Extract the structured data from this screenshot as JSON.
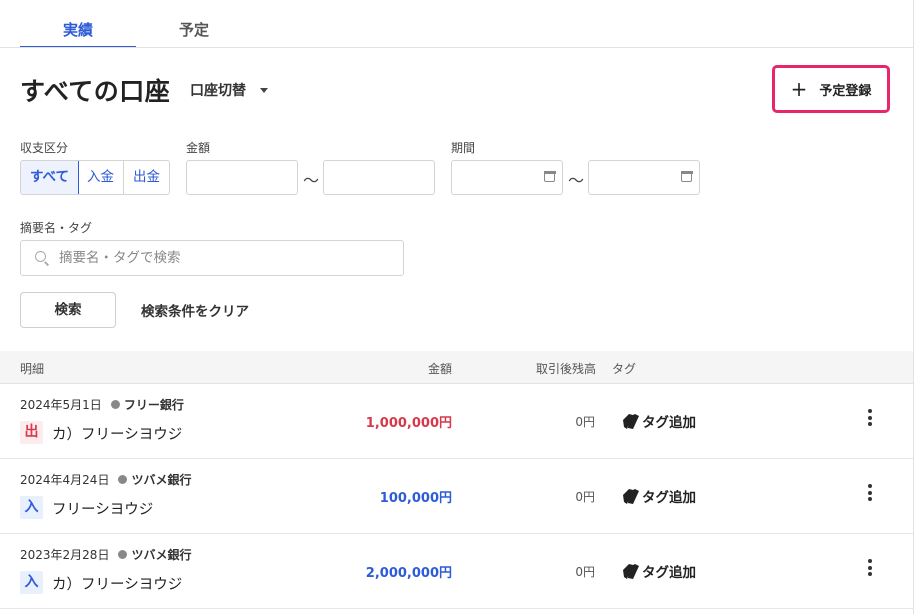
{
  "tabs": [
    {
      "label": "実績",
      "active": true
    },
    {
      "label": "予定",
      "active": false
    }
  ],
  "header": {
    "title": "すべての口座",
    "account_switch_label": "口座切替",
    "plan_button_label": "予定登録",
    "plan_button_icon": "plus-icon",
    "highlight_color": "#e8266b"
  },
  "filters": {
    "type_label": "収支区分",
    "type_options": [
      "すべて",
      "入金",
      "出金"
    ],
    "type_selected": "すべて",
    "amount_label": "金額",
    "amount_from": "",
    "amount_to": "",
    "range_separator": "〜",
    "period_label": "期間",
    "period_from": "",
    "period_to": "",
    "keyword_label": "摘要名・タグ",
    "keyword_placeholder": "摘要名・タグで検索",
    "search_button": "検索",
    "clear_button": "検索条件をクリア"
  },
  "table": {
    "headers": {
      "detail": "明細",
      "amount": "金額",
      "balance": "取引後残高",
      "tag": "タグ"
    },
    "rows": [
      {
        "date": "2024年5月1日",
        "bank": "フリー銀行",
        "kind": "出",
        "desc": "カ）フリーシヨウジ",
        "amount": "1,000,000円",
        "balance": "0円",
        "tag_action": "タグ追加"
      },
      {
        "date": "2024年4月24日",
        "bank": "ツバメ銀行",
        "kind": "入",
        "desc": "フリーシヨウジ",
        "amount": "100,000円",
        "balance": "0円",
        "tag_action": "タグ追加"
      },
      {
        "date": "2023年2月28日",
        "bank": "ツバメ銀行",
        "kind": "入",
        "desc": "カ）フリーシヨウジ",
        "amount": "2,000,000円",
        "balance": "0円",
        "tag_action": "タグ追加"
      }
    ]
  },
  "colors": {
    "accent": "#2e5bd6",
    "outgoing": "#d6394a",
    "incoming": "#2e5bd6"
  }
}
